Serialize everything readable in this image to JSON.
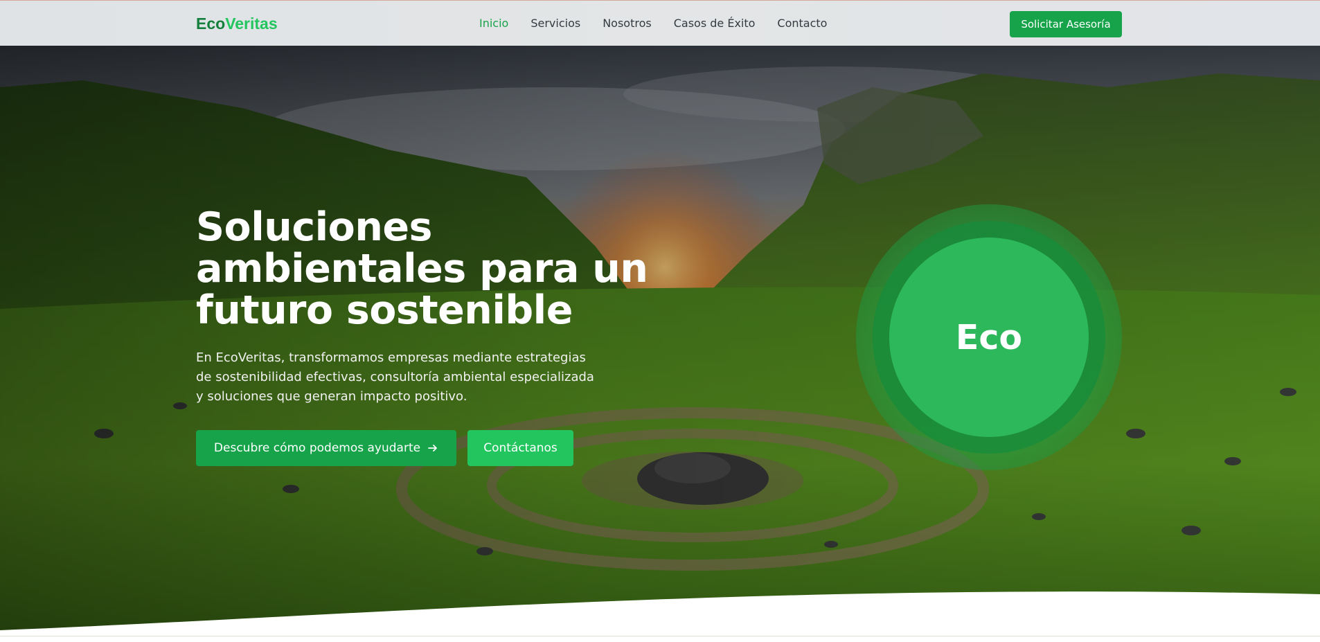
{
  "brand": {
    "part1": "Eco",
    "part2": "Veritas"
  },
  "nav": {
    "items": [
      {
        "label": "Inicio",
        "active": true
      },
      {
        "label": "Servicios",
        "active": false
      },
      {
        "label": "Nosotros",
        "active": false
      },
      {
        "label": "Casos de Éxito",
        "active": false
      },
      {
        "label": "Contacto",
        "active": false
      }
    ],
    "cta_label": "Solicitar Asesoría"
  },
  "hero": {
    "title_line1": "Soluciones",
    "title_line2": "ambientales para un",
    "title_line3": "futuro sostenible",
    "description": "En EcoVeritas, transformamos empresas mediante estrategias de sostenibilidad efectivas, consultoría ambiental especializada y soluciones que generan impacto positivo.",
    "primary_button": "Descubre cómo podemos ayudarte",
    "primary_button_icon": "arrow-right-icon",
    "secondary_button": "Contáctanos",
    "badge_text": "Eco"
  },
  "colors": {
    "brand_dark_green": "#15803d",
    "brand_green": "#22c55e",
    "button_green": "#16a34a",
    "nav_active": "#1aa34a"
  }
}
